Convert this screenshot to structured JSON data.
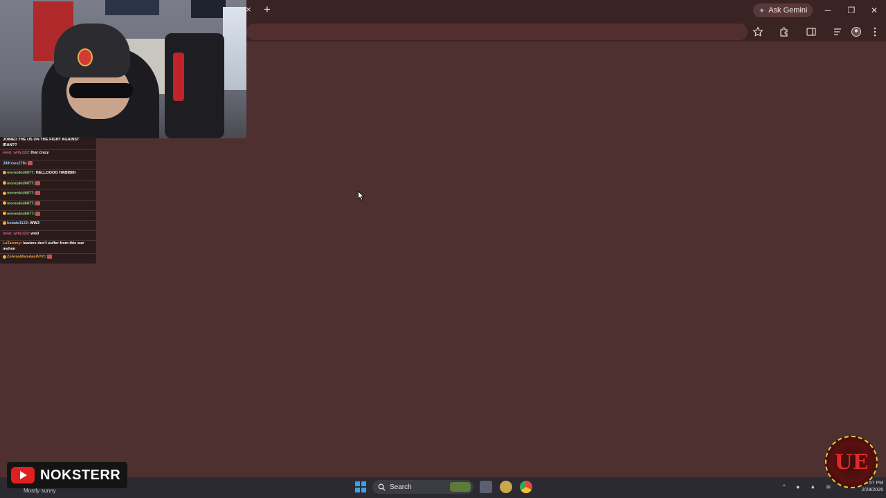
{
  "browser": {
    "tab_close_glyph": "×",
    "new_tab_glyph": "+",
    "gemini_label": "Ask Gemini",
    "window_controls": {
      "minimize": "─",
      "restore": "❐",
      "close": "✕"
    },
    "page_background": "#4f3030"
  },
  "chat": {
    "messages": [
      {
        "user": "",
        "text": "JOINED THE US ON THE FIGHT AGAINST IRAN??",
        "color": "#ffffff",
        "dot": false,
        "emote": false
      },
      {
        "user": "west_willy122",
        "text": ": that crazy",
        "color": "#d9608a",
        "dot": false,
        "emote": false
      },
      {
        "user": "JiliKews27lk",
        "text": ":",
        "color": "#8fd0ff",
        "dot": false,
        "emote": true
      },
      {
        "user": "meneskid6877",
        "text": ": HELLOOOO HABIBIIII",
        "color": "#8bd47a",
        "dot": true,
        "emote": false
      },
      {
        "user": "meneskid6877",
        "text": ":",
        "color": "#8bd47a",
        "dot": true,
        "emote": true
      },
      {
        "user": "meneskid6877",
        "text": ":",
        "color": "#8bd47a",
        "dot": true,
        "emote": true
      },
      {
        "user": "meneskid6877",
        "text": ":",
        "color": "#8bd47a",
        "dot": true,
        "emote": true
      },
      {
        "user": "meneskid6877",
        "text": ":",
        "color": "#8bd47a",
        "dot": true,
        "emote": true
      },
      {
        "user": "kolade1122",
        "text": ": WW3",
        "color": "#9ad0ff",
        "dot": true,
        "emote": false
      },
      {
        "user": "west_willy122",
        "text": ": ww3",
        "color": "#d9608a",
        "dot": false,
        "emote": false
      },
      {
        "user": "LaTammy",
        "text": ": leaders don't suffer from this war mehnn",
        "color": "#e8a040",
        "dot": false,
        "emote": false
      },
      {
        "user": "ZohranMamdaniNYC",
        "text": ":",
        "color": "#e8a040",
        "dot": true,
        "emote": true
      }
    ]
  },
  "taskbar": {
    "weather_text": "Mostly sunny",
    "search_label": "Search",
    "time": "4:57 PM",
    "date": "2/28/2026"
  },
  "branding": {
    "channel_name": "NOKSTERR",
    "logo_text": "UE"
  }
}
